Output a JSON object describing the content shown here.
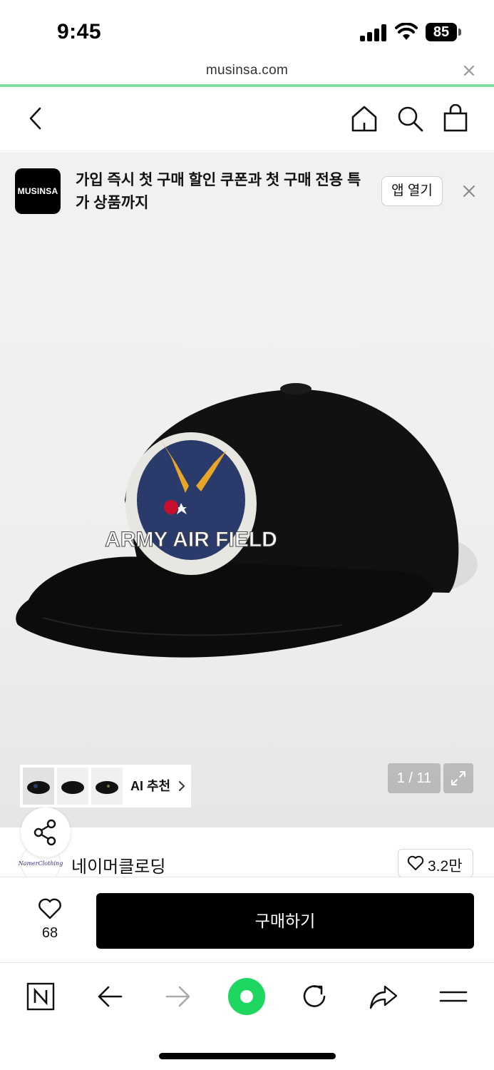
{
  "status_bar": {
    "time": "9:45",
    "battery": "85"
  },
  "url_bar": {
    "url": "musinsa.com"
  },
  "promo": {
    "logo_text": "MUSINSA",
    "text": "가입 즉시 첫 구매 할인 쿠폰과 첫 구매 전용 특가 상품까지",
    "open_app_label": "앱 열기"
  },
  "gallery": {
    "ai_label": "AI 추천",
    "page_counter": "1 / 11",
    "cap_patch_text": "ARMY AIR FIELD",
    "thumbnails": [
      "thumb-1",
      "thumb-2",
      "thumb-3"
    ]
  },
  "brand": {
    "avatar_text": "NamerClothing",
    "name": "네이머클로딩",
    "like_count": "3.2만"
  },
  "purchase": {
    "wish_count": "68",
    "buy_label": "구매하기"
  },
  "colors": {
    "accent_green": "#1ed760",
    "progress_green": "#7ddba1",
    "buy_button": "#000000"
  }
}
